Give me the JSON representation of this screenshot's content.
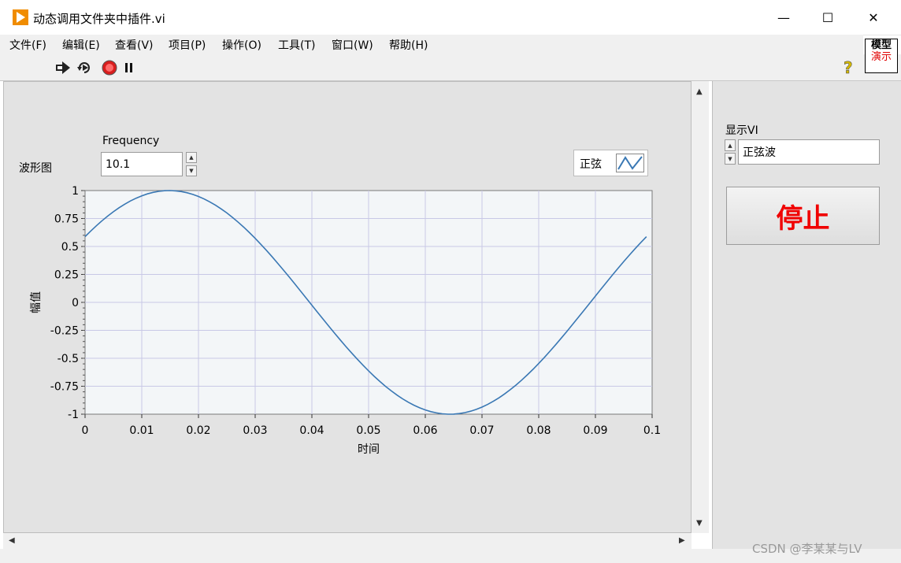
{
  "window": {
    "title": "动态调用文件夹中插件.vi",
    "controls": {
      "minimize": "—",
      "maximize": "☐",
      "close": "✕"
    }
  },
  "menu": {
    "items": [
      "文件(F)",
      "编辑(E)",
      "查看(V)",
      "项目(P)",
      "操作(O)",
      "工具(T)",
      "窗口(W)",
      "帮助(H)"
    ]
  },
  "toolbar": {
    "icons": [
      "run-icon",
      "run-continuously-icon",
      "abort-icon",
      "pause-icon"
    ],
    "help_glyph": "?"
  },
  "model_box": {
    "line1": "模型",
    "line2": "演示"
  },
  "frequency": {
    "label": "Frequency",
    "value": "10.1"
  },
  "waveform": {
    "label": "波形图",
    "legend_name": "正弦"
  },
  "display_vi": {
    "label": "显示VI",
    "value": "正弦波"
  },
  "stop_button": {
    "label": "停止"
  },
  "watermark": "CSDN @李某某与LV",
  "colors": {
    "trace": "#3a78b4",
    "plot_bg": "#f3f6f8",
    "grid": "#c8c8e6",
    "stop_text": "#f00000"
  },
  "chart_data": {
    "type": "line",
    "xlabel": "时间",
    "ylabel": "幅值",
    "xlim": [
      0,
      0.1
    ],
    "ylim": [
      -1,
      1
    ],
    "x_ticks": [
      "0",
      "0.01",
      "0.02",
      "0.03",
      "0.04",
      "0.05",
      "0.06",
      "0.07",
      "0.08",
      "0.09",
      "0.1"
    ],
    "y_ticks": [
      "1",
      "0.75",
      "0.5",
      "0.25",
      "0",
      "-0.25",
      "-0.5",
      "-0.75",
      "-1"
    ],
    "grid": true,
    "legend": "top-right",
    "series": [
      {
        "name": "正弦",
        "frequency": 10.1,
        "phase_deg": 36,
        "x_start": 0,
        "x_end": 0.099,
        "samples": 100
      }
    ]
  }
}
